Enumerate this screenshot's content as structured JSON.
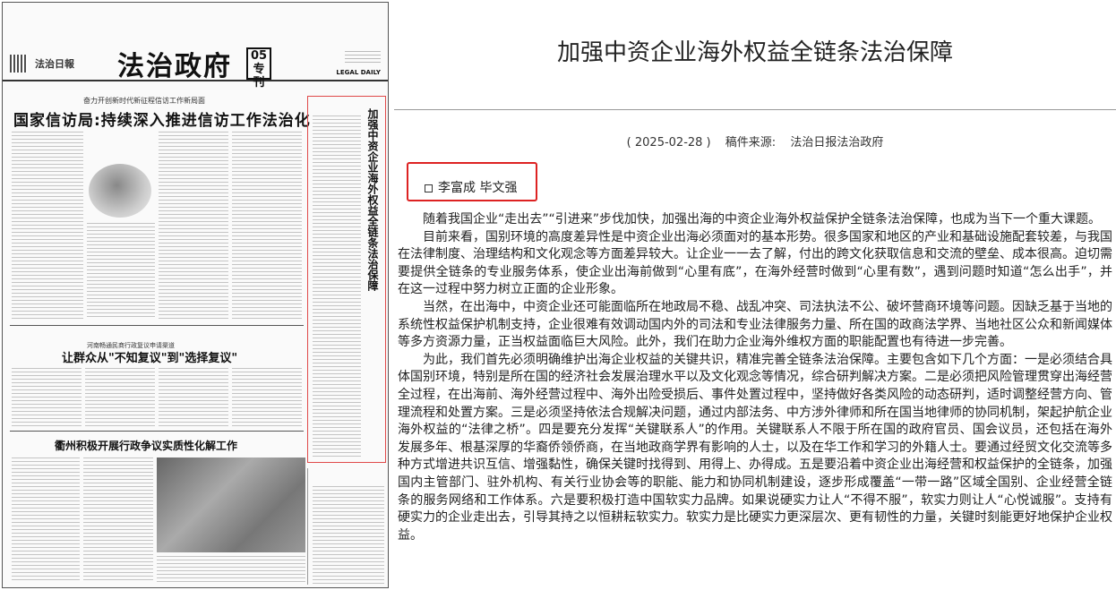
{
  "paper": {
    "masthead_title": "法治政府",
    "issue_number": "05",
    "issue_label": "专刊",
    "logo_text": "法治日報",
    "english_name": "LEGAL DAILY",
    "kicker1": "奋力开创新时代新征程信访工作新局面",
    "headline1": "国家信访局:持续深入推进信访工作法治化",
    "kicker2": "河南畅通民商行政复议申请渠道",
    "headline2": "让群众从\"不知复议\"到\"选择复议\"",
    "headline3": "衢州积极开展行政争议实质性化解工作",
    "vertical_title": "加强中资企业海外权益全链条法治保障"
  },
  "article": {
    "title": "加强中资企业海外权益全链条法治保障",
    "date": "( 2025-02-28 )",
    "source_label": "稿件来源:",
    "source": "法治日报法治政府",
    "authors": "李富成 毕文强",
    "paragraphs": [
      "随着我国企业“走出去”“引进来”步伐加快，加强出海的中资企业海外权益保护全链条法治保障，也成为当下一个重大课题。",
      "目前来看，国别环境的高度差异性是中资企业出海必须面对的基本形势。很多国家和地区的产业和基础设施配套较差，与我国在法律制度、治理结构和文化观念等方面差异较大。让企业一一去了解，付出的跨文化获取信息和交流的壁垒、成本很高。迫切需要提供全链条的专业服务体系，使企业出海前做到“心里有底”，在海外经营时做到“心里有数”，遇到问题时知道“怎么出手”，并在这一过程中努力树立正面的企业形象。",
      "当然，在出海中，中资企业还可能面临所在地政局不稳、战乱冲突、司法执法不公、破坏营商环境等问题。因缺乏基于当地的系统性权益保护机制支持，企业很难有效调动国内外的司法和专业法律服务力量、所在国的政商法学界、当地社区公众和新闻媒体等多方资源力量，正当权益面临巨大风险。此外，我们在助力企业海外维权方面的职能配置也有待进一步完善。",
      "为此，我们首先必须明确维护出海企业权益的关键共识，精准完善全链条法治保障。主要包含如下几个方面：一是必须结合具体国别环境，特别是所在国的经济社会发展治理水平以及文化观念等情况，综合研判解决方案。二是必须把风险管理贯穿出海经营全过程，在出海前、海外经营过程中、海外出险受损后、事件处置过程中，坚持做好各类风险的动态研判，适时调整经营方向、管理流程和处置方案。三是必须坚持依法合规解决问题，通过内部法务、中方涉外律师和所在国当地律师的协同机制，架起护航企业海外权益的“法律之桥”。四是要充分发挥“关键联系人”的作用。关键联系人不限于所在国的政府官员、国会议员，还包括在海外发展多年、根基深厚的华裔侨领侨商，在当地政商学界有影响的人士，以及在华工作和学习的外籍人士。要通过经贸文化交流等多种方式增进共识互信、增强黏性，确保关键时找得到、用得上、办得成。五是要沿着中资企业出海经营和权益保护的全链条，加强国内主管部门、驻外机构、有关行业协会等的职能、能力和协同机制建设，逐步形成覆盖“一带一路”区域全国别、企业经营全链条的服务网络和工作体系。六是要积极打造中国软实力品牌。如果说硬实力让人“不得不服”，软实力则让人“心悦诚服”。支持有硬实力的企业走出去，引导其持之以恒耕耘软实力。软实力是比硬实力更深层次、更有韧性的力量，关键时刻能更好地保护企业权益。"
    ]
  }
}
